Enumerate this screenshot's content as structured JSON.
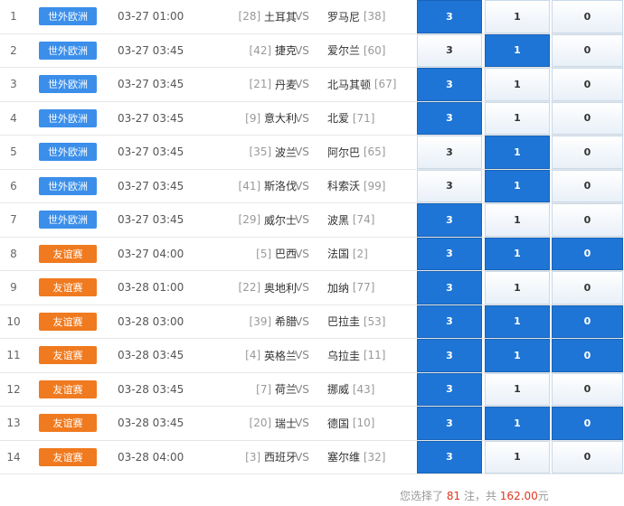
{
  "matches": [
    {
      "no": "1",
      "league": "世外欧洲",
      "league_type": "euro",
      "time": "03-27 01:00",
      "home_rank": "[28]",
      "home": "土耳其",
      "vs": "VS",
      "away": "罗马尼",
      "away_rank": "[38]",
      "opt3": "3",
      "opt1": "1",
      "opt0": "0",
      "sel3": true,
      "sel1": false,
      "sel0": false
    },
    {
      "no": "2",
      "league": "世外欧洲",
      "league_type": "euro",
      "time": "03-27 03:45",
      "home_rank": "[42]",
      "home": "捷克",
      "vs": "VS",
      "away": "爱尔兰",
      "away_rank": "[60]",
      "opt3": "3",
      "opt1": "1",
      "opt0": "0",
      "sel3": false,
      "sel1": true,
      "sel0": false
    },
    {
      "no": "3",
      "league": "世外欧洲",
      "league_type": "euro",
      "time": "03-27 03:45",
      "home_rank": "[21]",
      "home": "丹麦",
      "vs": "VS",
      "away": "北马其顿",
      "away_rank": "[67]",
      "opt3": "3",
      "opt1": "1",
      "opt0": "0",
      "sel3": true,
      "sel1": false,
      "sel0": false
    },
    {
      "no": "4",
      "league": "世外欧洲",
      "league_type": "euro",
      "time": "03-27 03:45",
      "home_rank": "[9]",
      "home": "意大利",
      "vs": "VS",
      "away": "北爱",
      "away_rank": "[71]",
      "opt3": "3",
      "opt1": "1",
      "opt0": "0",
      "sel3": true,
      "sel1": false,
      "sel0": false
    },
    {
      "no": "5",
      "league": "世外欧洲",
      "league_type": "euro",
      "time": "03-27 03:45",
      "home_rank": "[35]",
      "home": "波兰",
      "vs": "VS",
      "away": "阿尔巴",
      "away_rank": "[65]",
      "opt3": "3",
      "opt1": "1",
      "opt0": "0",
      "sel3": false,
      "sel1": true,
      "sel0": false
    },
    {
      "no": "6",
      "league": "世外欧洲",
      "league_type": "euro",
      "time": "03-27 03:45",
      "home_rank": "[41]",
      "home": "斯洛伐",
      "vs": "VS",
      "away": "科索沃",
      "away_rank": "[99]",
      "opt3": "3",
      "opt1": "1",
      "opt0": "0",
      "sel3": false,
      "sel1": true,
      "sel0": false
    },
    {
      "no": "7",
      "league": "世外欧洲",
      "league_type": "euro",
      "time": "03-27 03:45",
      "home_rank": "[29]",
      "home": "威尔士",
      "vs": "VS",
      "away": "波黑",
      "away_rank": "[74]",
      "opt3": "3",
      "opt1": "1",
      "opt0": "0",
      "sel3": true,
      "sel1": false,
      "sel0": false
    },
    {
      "no": "8",
      "league": "友谊赛",
      "league_type": "friendly",
      "time": "03-27 04:00",
      "home_rank": "[5]",
      "home": "巴西",
      "vs": "VS",
      "away": "法国",
      "away_rank": "[2]",
      "opt3": "3",
      "opt1": "1",
      "opt0": "0",
      "sel3": true,
      "sel1": true,
      "sel0": true
    },
    {
      "no": "9",
      "league": "友谊赛",
      "league_type": "friendly",
      "time": "03-28 01:00",
      "home_rank": "[22]",
      "home": "奥地利",
      "vs": "VS",
      "away": "加纳",
      "away_rank": "[77]",
      "opt3": "3",
      "opt1": "1",
      "opt0": "0",
      "sel3": true,
      "sel1": false,
      "sel0": false
    },
    {
      "no": "10",
      "league": "友谊赛",
      "league_type": "friendly",
      "time": "03-28 03:00",
      "home_rank": "[39]",
      "home": "希腊",
      "vs": "VS",
      "away": "巴拉圭",
      "away_rank": "[53]",
      "opt3": "3",
      "opt1": "1",
      "opt0": "0",
      "sel3": true,
      "sel1": true,
      "sel0": true
    },
    {
      "no": "11",
      "league": "友谊赛",
      "league_type": "friendly",
      "time": "03-28 03:45",
      "home_rank": "[4]",
      "home": "英格兰",
      "vs": "VS",
      "away": "乌拉圭",
      "away_rank": "[11]",
      "opt3": "3",
      "opt1": "1",
      "opt0": "0",
      "sel3": true,
      "sel1": true,
      "sel0": true
    },
    {
      "no": "12",
      "league": "友谊赛",
      "league_type": "friendly",
      "time": "03-28 03:45",
      "home_rank": "[7]",
      "home": "荷兰",
      "vs": "VS",
      "away": "挪威",
      "away_rank": "[43]",
      "opt3": "3",
      "opt1": "1",
      "opt0": "0",
      "sel3": true,
      "sel1": false,
      "sel0": false
    },
    {
      "no": "13",
      "league": "友谊赛",
      "league_type": "friendly",
      "time": "03-28 03:45",
      "home_rank": "[20]",
      "home": "瑞士",
      "vs": "VS",
      "away": "德国",
      "away_rank": "[10]",
      "opt3": "3",
      "opt1": "1",
      "opt0": "0",
      "sel3": true,
      "sel1": true,
      "sel0": true
    },
    {
      "no": "14",
      "league": "友谊赛",
      "league_type": "friendly",
      "time": "03-28 04:00",
      "home_rank": "[3]",
      "home": "西班牙",
      "vs": "VS",
      "away": "塞尔维",
      "away_rank": "[32]",
      "opt3": "3",
      "opt1": "1",
      "opt0": "0",
      "sel3": true,
      "sel1": false,
      "sel0": false
    }
  ],
  "summary": {
    "prefix": "您选择了",
    "count": "81",
    "middle": "注，共",
    "amount": "162.00",
    "suffix": "元"
  },
  "colors": {
    "euro_badge": "#3b8fea",
    "friendly_badge": "#f07a1f",
    "selected": "#1e75d6",
    "highlight": "#e0361e"
  }
}
